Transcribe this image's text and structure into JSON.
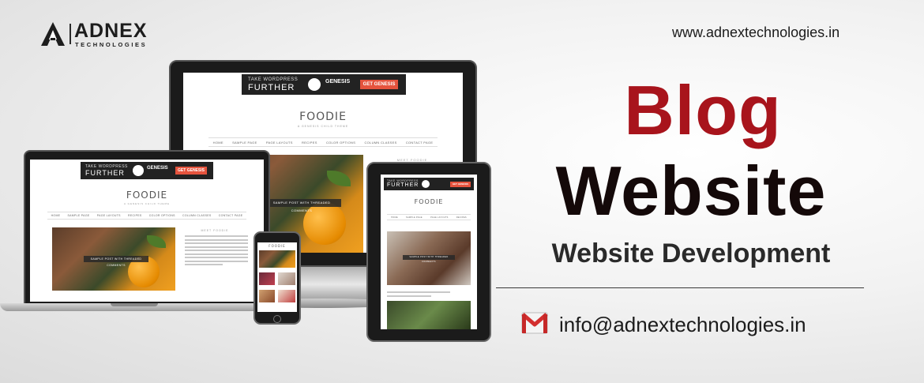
{
  "logo": {
    "name": "ADNEX",
    "sub": "TECHNOLOGIES"
  },
  "site_url": "www.adnextechnologies.in",
  "headline": {
    "line1": "Blog",
    "line2": "Website"
  },
  "subtitle": "Website Development",
  "email": "info@adnextechnologies.in",
  "colors": {
    "headline_red": "#a8141c",
    "headline_dark": "#140909",
    "banner_button": "#e5533d"
  },
  "mockup": {
    "banner_line1": "TAKE WORDPRESS",
    "banner_line2": "FURTHER",
    "banner_brand": "GENESIS",
    "banner_brand_sub": "framework",
    "banner_button": "GET GENESIS",
    "site_title": "FOODIE",
    "tagline": "A GENESIS CHILD THEME",
    "nav": [
      "HOME",
      "SAMPLE PAGE",
      "PAGE LAYOUTS",
      "RECIPES",
      "COLOR OPTIONS",
      "COLUMN CLASSES",
      "CONTACT PAGE"
    ],
    "caption": "SAMPLE POST WITH THREADED COMMENTS",
    "sidebar_heading": "MEET FOODIE"
  },
  "icons": {
    "logo": "adnex-logo-icon",
    "mail": "gmail-icon"
  }
}
